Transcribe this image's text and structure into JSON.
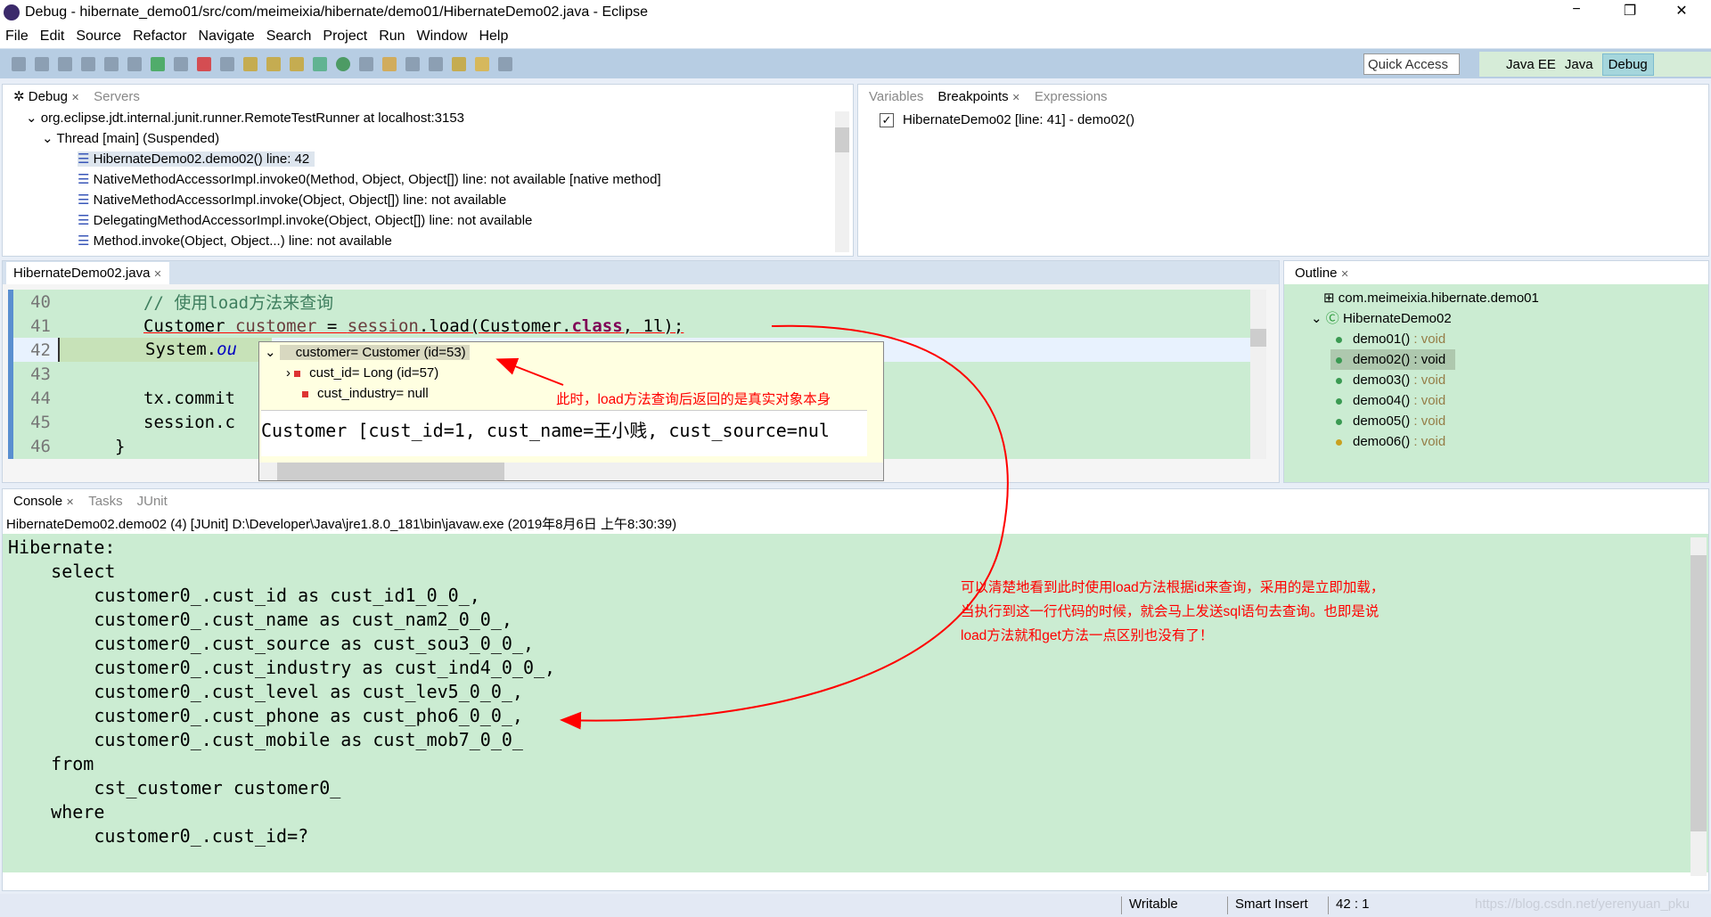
{
  "window": {
    "title": "Debug - hibernate_demo01/src/com/meimeixia/hibernate/demo01/HibernateDemo02.java - Eclipse",
    "minimize": "−",
    "restore": "❐",
    "close": "✕"
  },
  "menu": [
    "File",
    "Edit",
    "Source",
    "Refactor",
    "Navigate",
    "Search",
    "Project",
    "Run",
    "Window",
    "Help"
  ],
  "toolbar": {
    "quick_access": "Quick Access",
    "perspectives": [
      "Java EE",
      "Java",
      "Debug"
    ],
    "active_perspective": "Debug"
  },
  "debug": {
    "tabs": [
      "Debug",
      "Servers"
    ],
    "items": [
      "org.eclipse.jdt.internal.junit.runner.RemoteTestRunner at localhost:3153",
      "Thread [main] (Suspended)",
      "HibernateDemo02.demo02() line: 42",
      "NativeMethodAccessorImpl.invoke0(Method, Object, Object[]) line: not available [native method]",
      "NativeMethodAccessorImpl.invoke(Object, Object[]) line: not available",
      "DelegatingMethodAccessorImpl.invoke(Object, Object[]) line: not available",
      "Method.invoke(Object, Object...) line: not available"
    ]
  },
  "breakpoints": {
    "tabs": [
      "Variables",
      "Breakpoints",
      "Expressions"
    ],
    "items": [
      "HibernateDemo02 [line: 41] - demo02()"
    ]
  },
  "editor": {
    "tab": "HibernateDemo02.java",
    "lines": [
      {
        "n": "40",
        "code": "// 使用load方法来查询"
      },
      {
        "n": "41",
        "a": "Customer ",
        "b": "customer",
        "c": " = ",
        "d": "session",
        "e": ".load(Customer.",
        "f": "class",
        "g": ", 1l);"
      },
      {
        "n": "42",
        "a": "System.",
        "f": "ou"
      },
      {
        "n": "43",
        "a": ""
      },
      {
        "n": "44",
        "a": "tx.commit"
      },
      {
        "n": "45",
        "a": "session.c"
      },
      {
        "n": "46",
        "a": "}"
      }
    ]
  },
  "hover": {
    "rows": [
      "customer= Customer  (id=53)",
      "cust_id= Long  (id=57)",
      "cust_industry= null"
    ],
    "detail": "Customer [cust_id=1, cust_name=王小贱, cust_source=nul"
  },
  "outline": {
    "tab": "Outline",
    "package": "com.meimeixia.hibernate.demo01",
    "class": "HibernateDemo02",
    "methods": [
      "demo01()",
      "demo02()",
      "demo03()",
      "demo04()",
      "demo05()",
      "demo06()"
    ],
    "return_type": " : void",
    "selected": "demo02()"
  },
  "console": {
    "tabs": [
      "Console",
      "Tasks",
      "JUnit"
    ],
    "header": "HibernateDemo02.demo02 (4) [JUnit] D:\\Developer\\Java\\jre1.8.0_181\\bin\\javaw.exe (2019年8月6日 上午8:30:39)",
    "lines": [
      "Hibernate: ",
      "    select",
      "        customer0_.cust_id as cust_id1_0_0_,",
      "        customer0_.cust_name as cust_nam2_0_0_,",
      "        customer0_.cust_source as cust_sou3_0_0_,",
      "        customer0_.cust_industry as cust_ind4_0_0_,",
      "        customer0_.cust_level as cust_lev5_0_0_,",
      "        customer0_.cust_phone as cust_pho6_0_0_,",
      "        customer0_.cust_mobile as cust_mob7_0_0_ ",
      "    from",
      "        cst_customer customer0_ ",
      "    where",
      "        customer0_.cust_id=?"
    ]
  },
  "annotations": {
    "popup_note": "此时，load方法查询后返回的是真实对象本身",
    "console_note": [
      "可以清楚地看到此时使用load方法根据id来查询，采用的是立即加载，",
      "当执行到这一行代码的时候，就会马上发送sql语句去查询。也即是说",
      "load方法就和get方法一点区别也没有了！"
    ],
    "color": "#ff0000"
  },
  "status": {
    "writable": "Writable",
    "insert": "Smart Insert",
    "position": "42 : 1",
    "watermark": "https://blog.csdn.net/yerenyuan_pku"
  }
}
